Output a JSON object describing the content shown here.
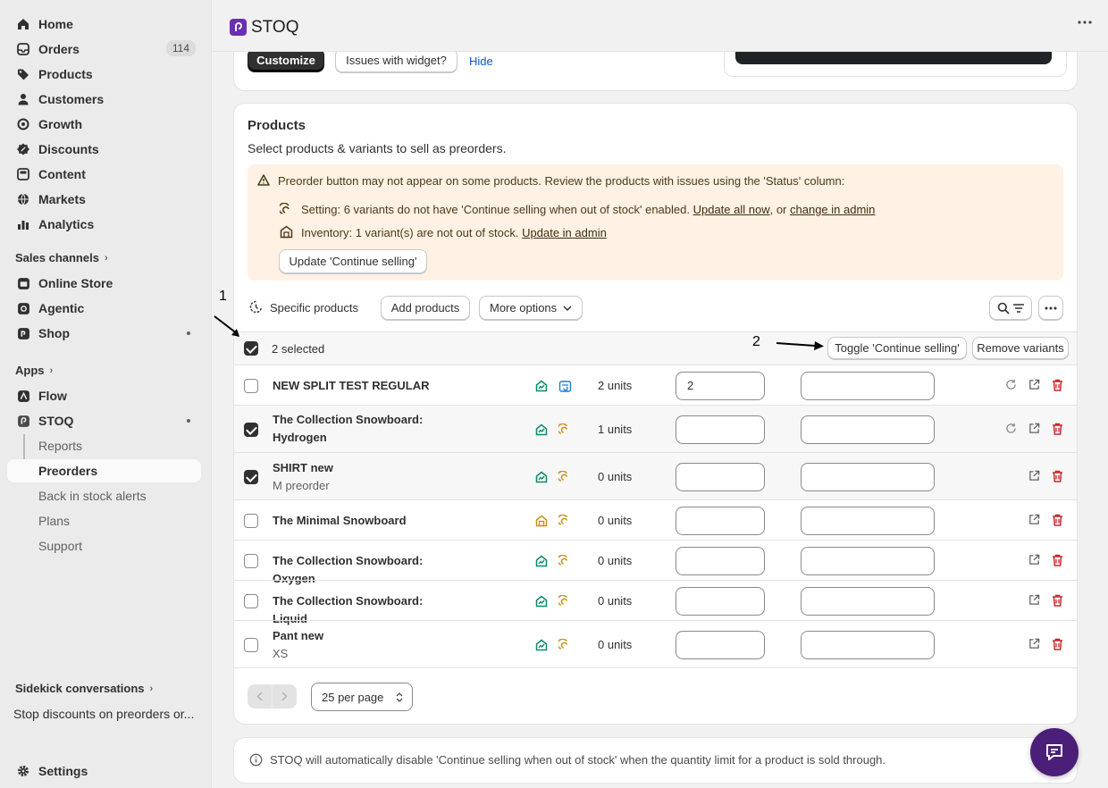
{
  "sidebar": {
    "items": [
      {
        "label": "Home",
        "icon": "home-icon"
      },
      {
        "label": "Orders",
        "icon": "orders-icon",
        "badge": "114"
      },
      {
        "label": "Products",
        "icon": "tag-icon"
      },
      {
        "label": "Customers",
        "icon": "person-icon"
      },
      {
        "label": "Growth",
        "icon": "growth-icon"
      },
      {
        "label": "Discounts",
        "icon": "discount-icon"
      },
      {
        "label": "Content",
        "icon": "content-icon"
      },
      {
        "label": "Markets",
        "icon": "globe-icon"
      },
      {
        "label": "Analytics",
        "icon": "analytics-icon"
      }
    ],
    "sales_channels_heading": "Sales channels",
    "channels": [
      {
        "label": "Online Store",
        "icon": "store-icon"
      },
      {
        "label": "Agentic",
        "icon": "agentic-icon"
      },
      {
        "label": "Shop",
        "icon": "shop-icon"
      }
    ],
    "apps_heading": "Apps",
    "apps": [
      {
        "label": "Flow",
        "icon": "flow-icon"
      },
      {
        "label": "STOQ",
        "icon": "stoq-icon"
      }
    ],
    "stoq_sub": [
      "Reports",
      "Preorders",
      "Back in stock alerts",
      "Plans",
      "Support"
    ],
    "sidekick_heading": "Sidekick conversations",
    "sidekick_item": "Stop discounts on preorders or...",
    "settings_label": "Settings"
  },
  "header": {
    "title": "STOQ"
  },
  "top_card": {
    "customize": "Customize",
    "issues": "Issues with widget?",
    "hide": "Hide"
  },
  "products_card": {
    "title": "Products",
    "subtitle": "Select products & variants to sell as preorders.",
    "banner": {
      "main": "Preorder button may not appear on some products. Review the products with issues using the 'Status' column:",
      "setting_text": "Setting: 6 variants do not have 'Continue selling when out of stock' enabled.",
      "update_all": "Update all now",
      "or": ", or",
      "change_admin": "change in admin",
      "inventory_text": "Inventory: 1 variant(s) are not out of stock.",
      "update_admin": "Update in admin",
      "update_btn": "Update 'Continue selling'"
    },
    "toolbar": {
      "specific": "Specific products",
      "add": "Add products",
      "more": "More options"
    },
    "bulk": {
      "selected": "2 selected",
      "toggle": "Toggle 'Continue selling'",
      "remove": "Remove variants"
    },
    "rows": [
      {
        "name": "NEW SPLIT TEST REGULAR",
        "sub": "",
        "units": "2 units",
        "qty": "2",
        "checked": false
      },
      {
        "name": "The Collection Snowboard: Hydrogen",
        "sub": "",
        "units": "1 units",
        "qty": "",
        "checked": true
      },
      {
        "name": "SHIRT new",
        "sub": "M preorder",
        "units": "0 units",
        "qty": "",
        "checked": true
      },
      {
        "name": "The Minimal Snowboard",
        "sub": "",
        "units": "0 units",
        "qty": "",
        "checked": false
      },
      {
        "name": "The Collection Snowboard: Oxygen",
        "sub": "",
        "units": "0 units",
        "qty": "",
        "checked": false
      },
      {
        "name": "The Collection Snowboard: Liquid",
        "sub": "",
        "units": "0 units",
        "qty": "",
        "checked": false
      },
      {
        "name": "Pant new",
        "sub": "XS",
        "units": "0 units",
        "qty": "",
        "checked": false
      }
    ],
    "per_page": "25 per page"
  },
  "info_text": "STOQ will automatically disable 'Continue selling when out of stock' when the quantity limit for a product is sold through.",
  "annotations": {
    "a1": "1",
    "a2": "2"
  },
  "colors": {
    "accent_link": "#005bd3",
    "banner_bg": "#fff1e3",
    "green": "#0c8a6a",
    "amber": "#c99212",
    "delete_red": "#c5282a",
    "stoq_purple": "#6b2fb3"
  }
}
